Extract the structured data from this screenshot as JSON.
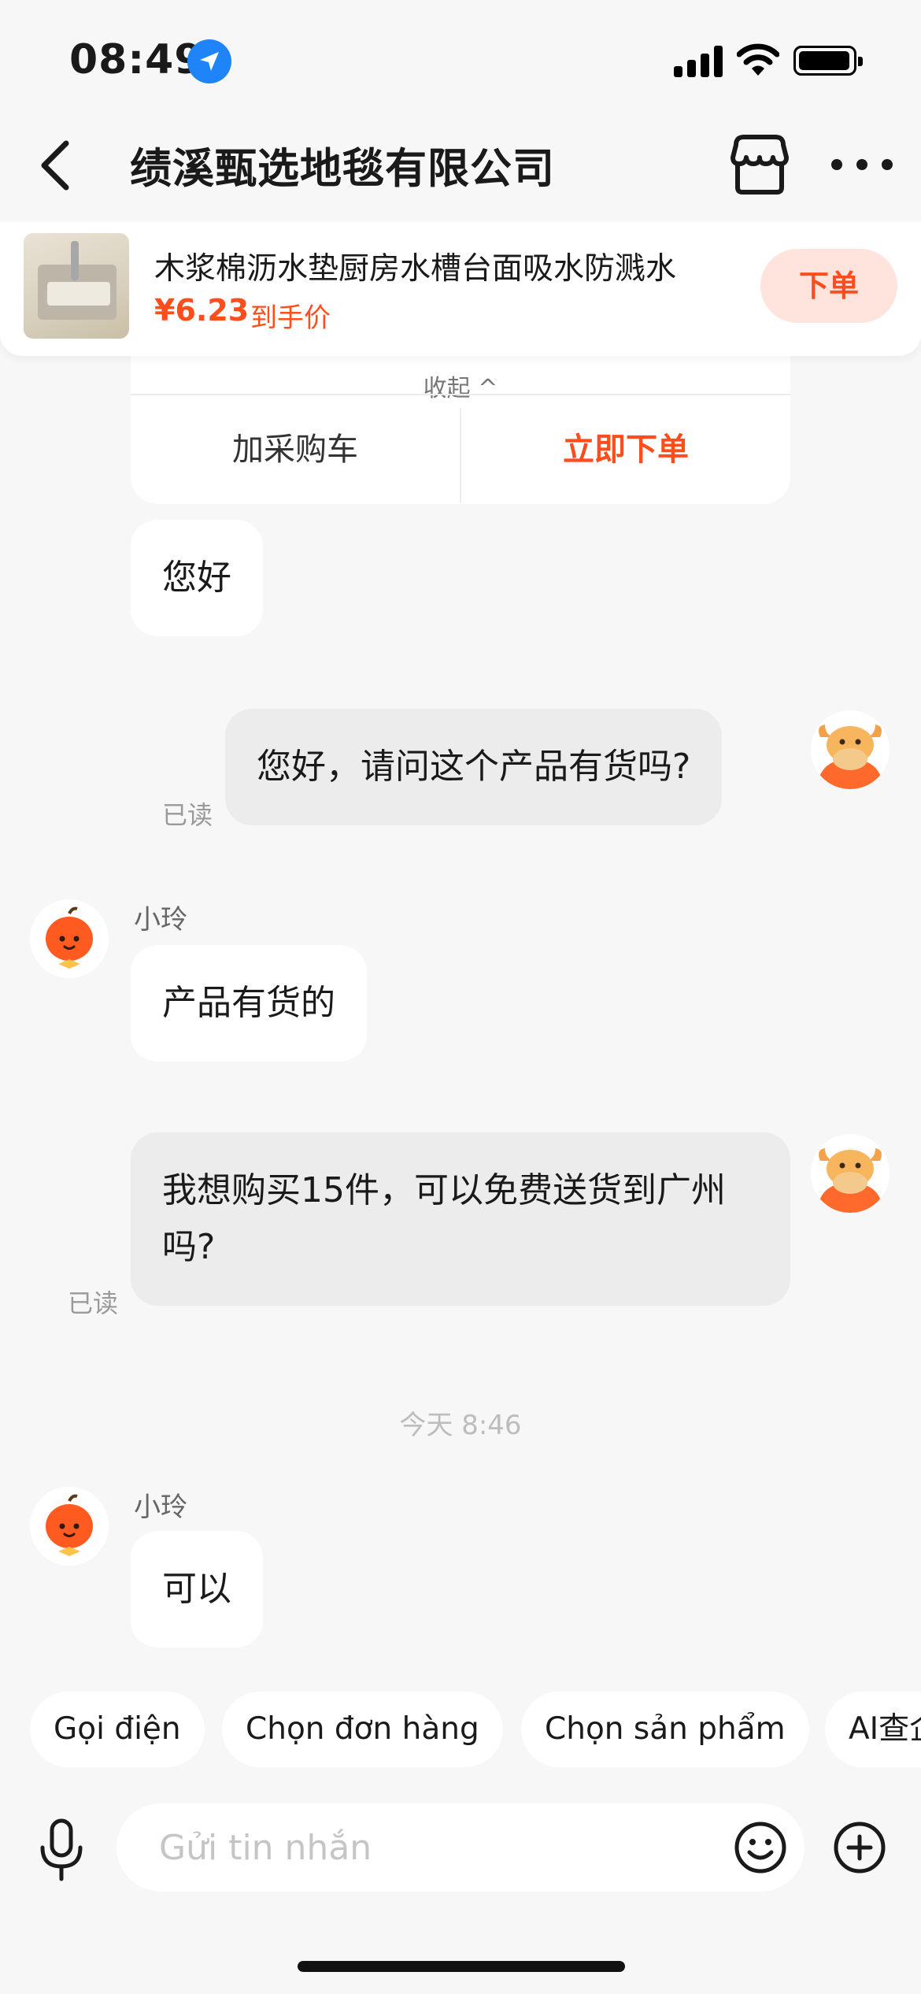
{
  "status_bar": {
    "time": "08:49"
  },
  "header": {
    "title": "绩溪甄选地毯有限公司"
  },
  "product": {
    "name": "木浆棉沥水垫厨房水槽台面吸水防溅水",
    "price": "¥6.23",
    "price_note": "到手价",
    "order_label": "下单"
  },
  "product_card": {
    "collapse_label": "收起 ^",
    "add_to_cart": "加采购车",
    "buy_now": "立即下单"
  },
  "messages": [
    {
      "from": "shop",
      "text": "您好"
    },
    {
      "from": "user",
      "text": "您好，请问这个产品有货吗?",
      "status": "已读"
    },
    {
      "from": "shop",
      "sender": "小玲",
      "text": "产品有货的"
    },
    {
      "from": "user",
      "text": "我想购买15件，可以免费送货到广州吗?",
      "status": "已读"
    },
    {
      "from": "shop",
      "sender": "小玲",
      "text": "可以"
    }
  ],
  "timestamp": "今天 8:46",
  "quick_actions": [
    "Gọi điện",
    "Chọn đơn hàng",
    "Chọn sản phẩm",
    "AI查企"
  ],
  "input": {
    "placeholder": "Gửi tin nhắn"
  },
  "colors": {
    "accent": "#ff4d1c",
    "location_blue": "#1e84f7",
    "avatar_orange": "#ff5a1f"
  }
}
